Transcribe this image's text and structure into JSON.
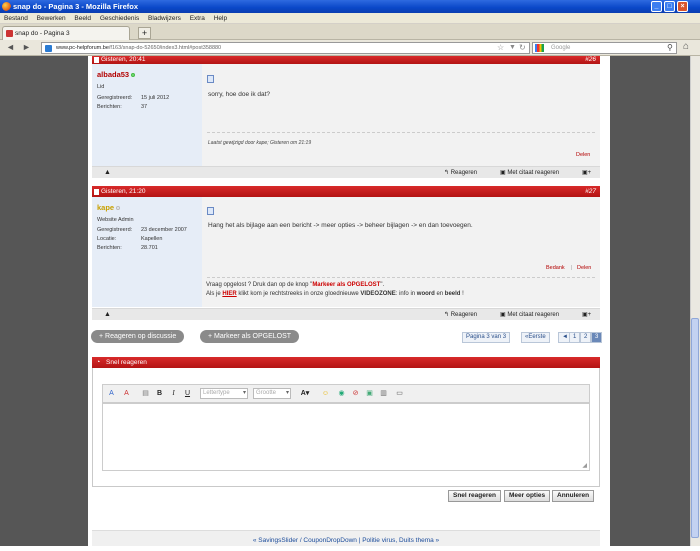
{
  "window": {
    "title": "snap do - Pagina 3 - Mozilla Firefox"
  },
  "menu": [
    "Bestand",
    "Bewerken",
    "Beeld",
    "Geschiedenis",
    "Bladwijzers",
    "Extra",
    "Help"
  ],
  "tab": {
    "title": "snap do - Pagina 3"
  },
  "nav": {
    "url_domain": "www.pc-helpforum.be",
    "url_path": "/f163/snap-do-52650/index3.html#post358880",
    "search_placeholder": "Google"
  },
  "post1": {
    "time": "Gisteren, 20:41",
    "number": "#26",
    "username": "albada53",
    "role": "Lid",
    "reg_label": "Geregistreerd:",
    "reg_value": "15 juli 2012",
    "posts_label": "Berichten:",
    "posts_value": "37",
    "text": "sorry, hoe doe ik dat?",
    "edited": "Laatst gewijzigd door kape; Gisteren om 21:19",
    "delete": "Delen",
    "reply": "Reageren",
    "quote": "Met citaat reageren"
  },
  "post2": {
    "time": "Gisteren, 21:20",
    "number": "#27",
    "username": "kape",
    "role": "Website Admin",
    "reg_label": "Geregistreerd:",
    "reg_value": "23 december 2007",
    "loc_label": "Locatie:",
    "loc_value": "Kapellen",
    "posts_label": "Berichten:",
    "posts_value": "28.701",
    "text": "Hang het als bijlage aan een bericht -> meer opties -> beheer bijlagen -> en dan toevoegen.",
    "thanks": "Bedank",
    "delete": "Delen",
    "sig1_a": "Vraag opgelost ? Druk dan op de knop \"",
    "sig1_b": "Markeer als OPGELOST",
    "sig1_c": "\".",
    "sig2_a": "Als je ",
    "sig2_b": "HIER",
    "sig2_c": " klikt kom je rechtstreeks in onze gloednieuwe ",
    "sig2_d": "VIDEOZONE",
    "sig2_e": ": info in ",
    "sig2_f": "woord",
    "sig2_g": " en ",
    "sig2_h": "beeld",
    "sig2_i": " !",
    "reply": "Reageren",
    "quote": "Met citaat reageren"
  },
  "actions": {
    "reply_thread": "+ Reageren op discussie",
    "mark_solved": "+ Markeer als OPGELOST"
  },
  "pagination": {
    "label": "Pagina 3 van 3",
    "first": "Eerste",
    "pages": [
      "1",
      "2",
      "3"
    ]
  },
  "quick_reply": {
    "title": "Snel reageren",
    "font_placeholder": "Lettertype",
    "size_placeholder": "Grootte",
    "submit": "Snel reageren",
    "more": "Meer opties",
    "cancel": "Annuleren"
  },
  "signature_bar": "« SavingsSlider / CouponDropDown | Politie virus, Duits thema »"
}
